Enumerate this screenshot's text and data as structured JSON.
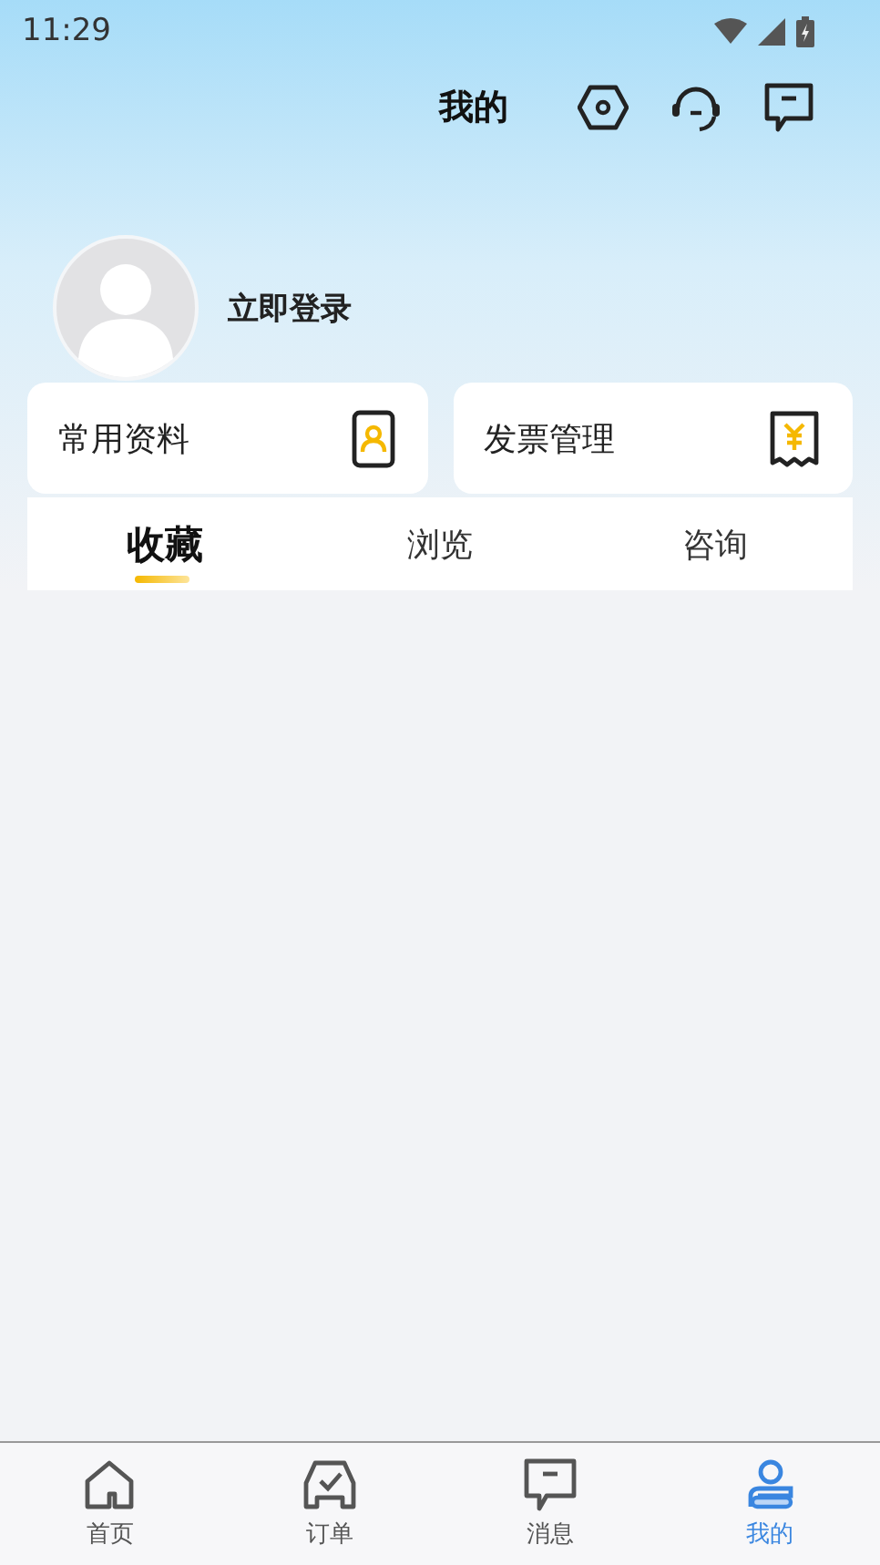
{
  "status_bar": {
    "time": "11:29"
  },
  "header": {
    "title": "我的"
  },
  "profile": {
    "login": "立即登录"
  },
  "shortcuts": [
    {
      "label": "常用资料",
      "kind": "profile"
    },
    {
      "label": "发票管理",
      "kind": "invoice"
    }
  ],
  "tabs": [
    {
      "label": "收藏",
      "selected": true
    },
    {
      "label": "浏览",
      "selected": false
    },
    {
      "label": "咨询",
      "selected": false
    }
  ],
  "nav": [
    {
      "label": "首页",
      "kind": "home",
      "selected": false
    },
    {
      "label": "订单",
      "kind": "order",
      "selected": false
    },
    {
      "label": "消息",
      "kind": "message",
      "selected": false
    },
    {
      "label": "我的",
      "kind": "me",
      "selected": true
    }
  ]
}
